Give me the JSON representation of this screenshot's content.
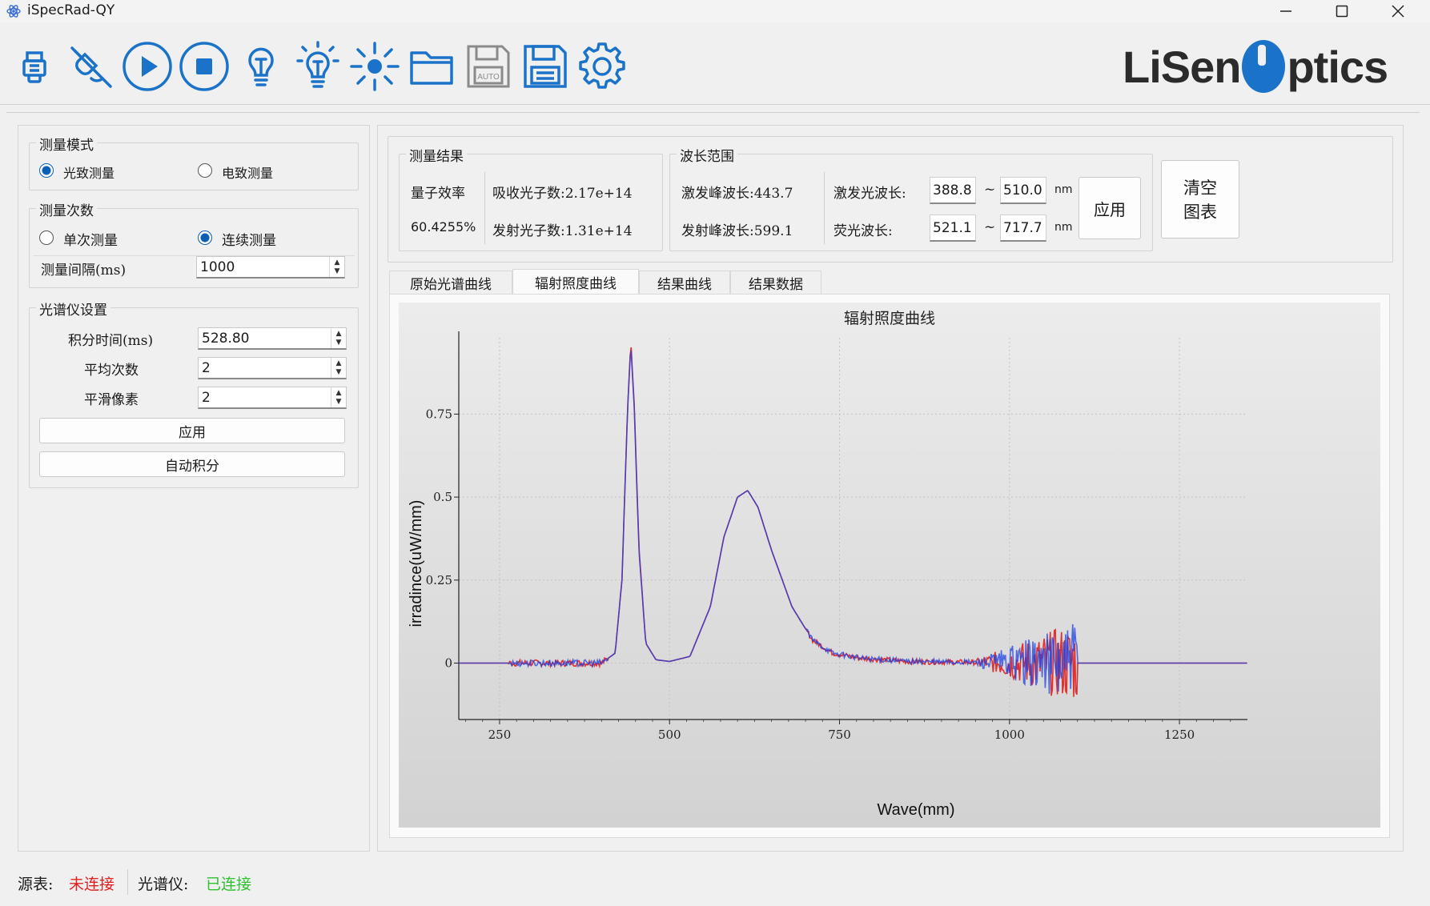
{
  "window": {
    "title": "iSpecRad-QY"
  },
  "toolbar": {
    "icons": [
      "usb-plug-icon",
      "disconnect-icon",
      "play-icon",
      "stop-icon",
      "bulb-icon",
      "bulb-on-icon",
      "light-source-icon",
      "folder-icon",
      "auto-save-icon",
      "save-icon",
      "gear-icon"
    ],
    "logo": {
      "text_left": "LiSen",
      "text_right": "ptics",
      "color": "#1a73c8"
    }
  },
  "left": {
    "mode": {
      "title": "测量模式",
      "option1": "光致测量",
      "option2": "电致测量",
      "selected": "光致测量"
    },
    "count": {
      "title": "测量次数",
      "option1": "单次测量",
      "option2": "连续测量",
      "selected": "连续测量",
      "interval_label": "测量间隔(ms)",
      "interval_value": "1000"
    },
    "spectro": {
      "title": "光谱仪设置",
      "integration_label": "积分时间(ms)",
      "integration_value": "528.80",
      "average_label": "平均次数",
      "average_value": "2",
      "smooth_label": "平滑像素",
      "smooth_value": "2",
      "apply_label": "应用",
      "auto_label": "自动积分"
    }
  },
  "results": {
    "title": "测量结果",
    "qe_label": "量子效率",
    "qe_value": "60.4255%",
    "abs_photons": "吸收光子数:2.17e+14",
    "emit_photons": "发射光子数:1.31e+14"
  },
  "wavelength": {
    "title": "波长范围",
    "ex_peak": "激发峰波长:443.7",
    "em_peak": "发射峰波长:599.1",
    "ex_label": "激发光波长:",
    "fl_label": "荧光波长:",
    "ex_from": "388.8",
    "ex_to": "510.0",
    "fl_from": "521.1",
    "fl_to": "717.7",
    "tilde": "~",
    "unit": "nm",
    "apply_label": "应用",
    "clear_label_1": "清空",
    "clear_label_2": "图表"
  },
  "tabs": [
    "原始光谱曲线",
    "辐射照度曲线",
    "结果曲线",
    "结果数据"
  ],
  "active_tab": "辐射照度曲线",
  "chart_data": {
    "type": "line",
    "title": "辐射照度曲线",
    "xlabel": "Wave(mm)",
    "ylabel": "irradince(uW/mm)",
    "xlim": [
      190,
      1350
    ],
    "ylim": [
      -0.17,
      0.98
    ],
    "xticks": [
      250,
      500,
      750,
      1000,
      1250
    ],
    "yticks": [
      0,
      0.25,
      0.5,
      0.75
    ],
    "ytick_labels": [
      "0",
      "0.25",
      "0.5",
      "0.75"
    ],
    "grid": true,
    "series": [
      {
        "color": "#e03030",
        "x": [
          190,
          260,
          400,
          420,
          430,
          438,
          443,
          448,
          455,
          465,
          480,
          500,
          530,
          560,
          580,
          600,
          615,
          630,
          650,
          680,
          710,
          740,
          780,
          850,
          950,
          1000,
          1050,
          1080,
          1095,
          1100,
          1350
        ],
        "y": [
          0,
          0,
          0,
          0.03,
          0.25,
          0.75,
          0.97,
          0.78,
          0.35,
          0.06,
          0.01,
          0.005,
          0.02,
          0.17,
          0.38,
          0.5,
          0.52,
          0.47,
          0.34,
          0.17,
          0.07,
          0.03,
          0.015,
          0.005,
          0.002,
          0,
          0,
          0,
          0,
          0,
          0
        ]
      },
      {
        "color": "#2040e0",
        "x": [
          190,
          260,
          400,
          420,
          430,
          438,
          443,
          448,
          455,
          465,
          480,
          500,
          530,
          560,
          580,
          600,
          615,
          630,
          650,
          680,
          710,
          740,
          780,
          850,
          950,
          1000,
          1050,
          1080,
          1095,
          1100,
          1350
        ],
        "y": [
          0,
          0,
          0,
          0.03,
          0.25,
          0.75,
          0.96,
          0.77,
          0.34,
          0.06,
          0.01,
          0.005,
          0.02,
          0.17,
          0.38,
          0.5,
          0.52,
          0.47,
          0.34,
          0.17,
          0.07,
          0.03,
          0.015,
          0.005,
          0.002,
          0,
          0,
          0,
          0,
          0,
          0
        ]
      }
    ]
  },
  "status": {
    "source_label": "源表:",
    "source_value": "未连接",
    "source_color": "#e02020",
    "spectro_label": "光谱仪:",
    "spectro_value": "已连接",
    "spectro_color": "#30c030"
  }
}
